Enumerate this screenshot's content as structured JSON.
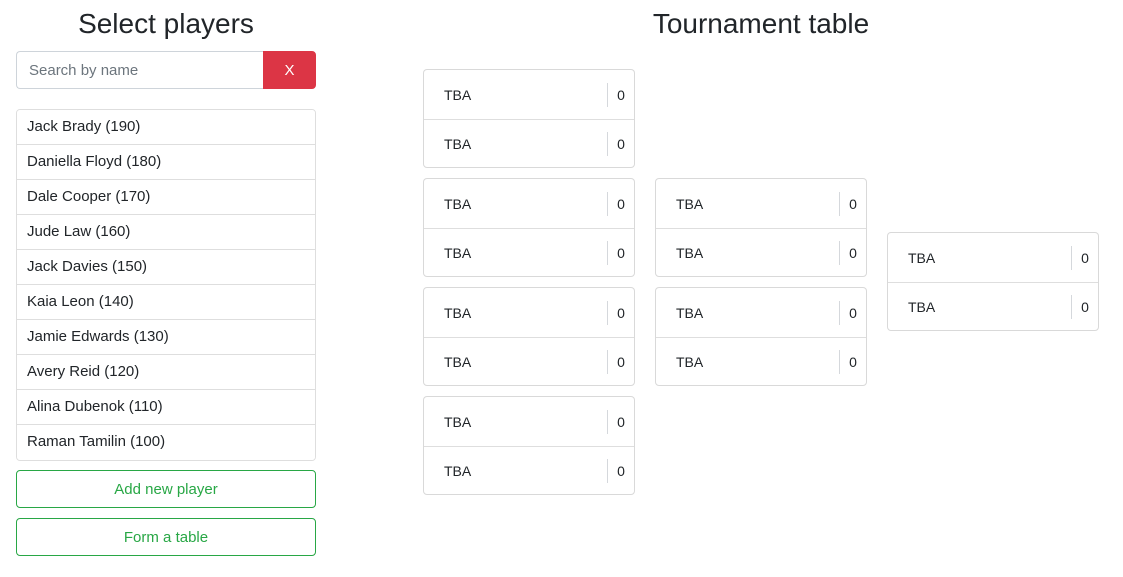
{
  "left_panel": {
    "title": "Select players",
    "search": {
      "placeholder": "Search by name",
      "value": "",
      "clear_label": "X"
    },
    "players": [
      "Jack Brady (190)",
      "Daniella Floyd (180)",
      "Dale Cooper (170)",
      "Jude Law (160)",
      "Jack Davies (150)",
      "Kaia Leon (140)",
      "Jamie Edwards (130)",
      "Avery Reid (120)",
      "Alina Dubenok (110)",
      "Raman Tamilin (100)"
    ],
    "add_label": "Add new player",
    "form_label": "Form a table"
  },
  "bracket": {
    "title": "Tournament table",
    "rounds": [
      {
        "matches": [
          {
            "slots": [
              {
                "name": "TBA",
                "score": "0"
              },
              {
                "name": "TBA",
                "score": "0"
              }
            ]
          },
          {
            "slots": [
              {
                "name": "TBA",
                "score": "0"
              },
              {
                "name": "TBA",
                "score": "0"
              }
            ]
          },
          {
            "slots": [
              {
                "name": "TBA",
                "score": "0"
              },
              {
                "name": "TBA",
                "score": "0"
              }
            ]
          },
          {
            "slots": [
              {
                "name": "TBA",
                "score": "0"
              },
              {
                "name": "TBA",
                "score": "0"
              }
            ]
          }
        ]
      },
      {
        "matches": [
          {
            "slots": [
              {
                "name": "TBA",
                "score": "0"
              },
              {
                "name": "TBA",
                "score": "0"
              }
            ]
          },
          {
            "slots": [
              {
                "name": "TBA",
                "score": "0"
              },
              {
                "name": "TBA",
                "score": "0"
              }
            ]
          }
        ]
      },
      {
        "matches": [
          {
            "slots": [
              {
                "name": "TBA",
                "score": "0"
              },
              {
                "name": "TBA",
                "score": "0"
              }
            ]
          }
        ]
      }
    ]
  }
}
